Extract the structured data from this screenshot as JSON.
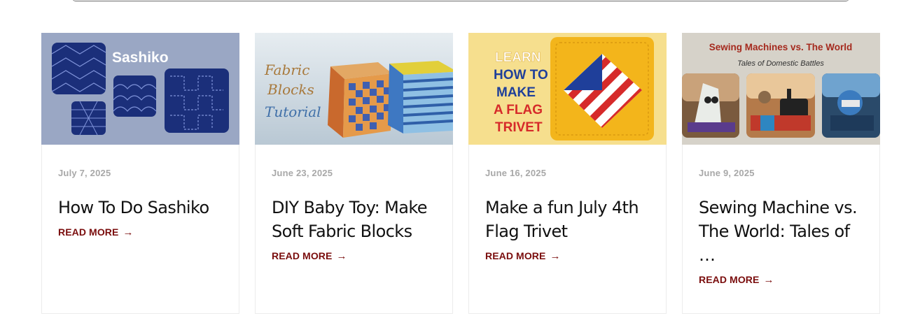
{
  "posts": [
    {
      "date": "July 7, 2025",
      "title": "How To Do Sashiko",
      "read_more": "READ MORE",
      "thumb_text": "Sashiko",
      "thumb_bg": "#9aa7c4"
    },
    {
      "date": "June 23, 2025",
      "title": "DIY Baby Toy: Make Soft Fabric Blocks",
      "read_more": "READ MORE",
      "thumb_text_1": "Fabric",
      "thumb_text_2": "Blocks",
      "thumb_text_3": "Tutorial",
      "thumb_bg": "#d9e2e8"
    },
    {
      "date": "June 16, 2025",
      "title": "Make a fun July 4th Flag Trivet",
      "read_more": "READ MORE",
      "thumb_text_1": "LEARN",
      "thumb_text_2": "HOW TO",
      "thumb_text_3": "MAKE",
      "thumb_text_4": "A FLAG",
      "thumb_text_5": "TRIVET",
      "thumb_bg": "#f6df8e"
    },
    {
      "date": "June 9, 2025",
      "title": "Sewing Machine vs. The World: Tales of …",
      "read_more": "READ MORE",
      "thumb_text_1": "Sewing Machines vs. The World",
      "thumb_text_2": "Tales of Domestic Battles",
      "thumb_bg": "#d6d2c9"
    }
  ],
  "colors": {
    "accent": "#7a0d0d",
    "date": "#a8a8a8",
    "title": "#111111"
  },
  "icons": {
    "read_more_arrow": "arrow-right-icon"
  }
}
